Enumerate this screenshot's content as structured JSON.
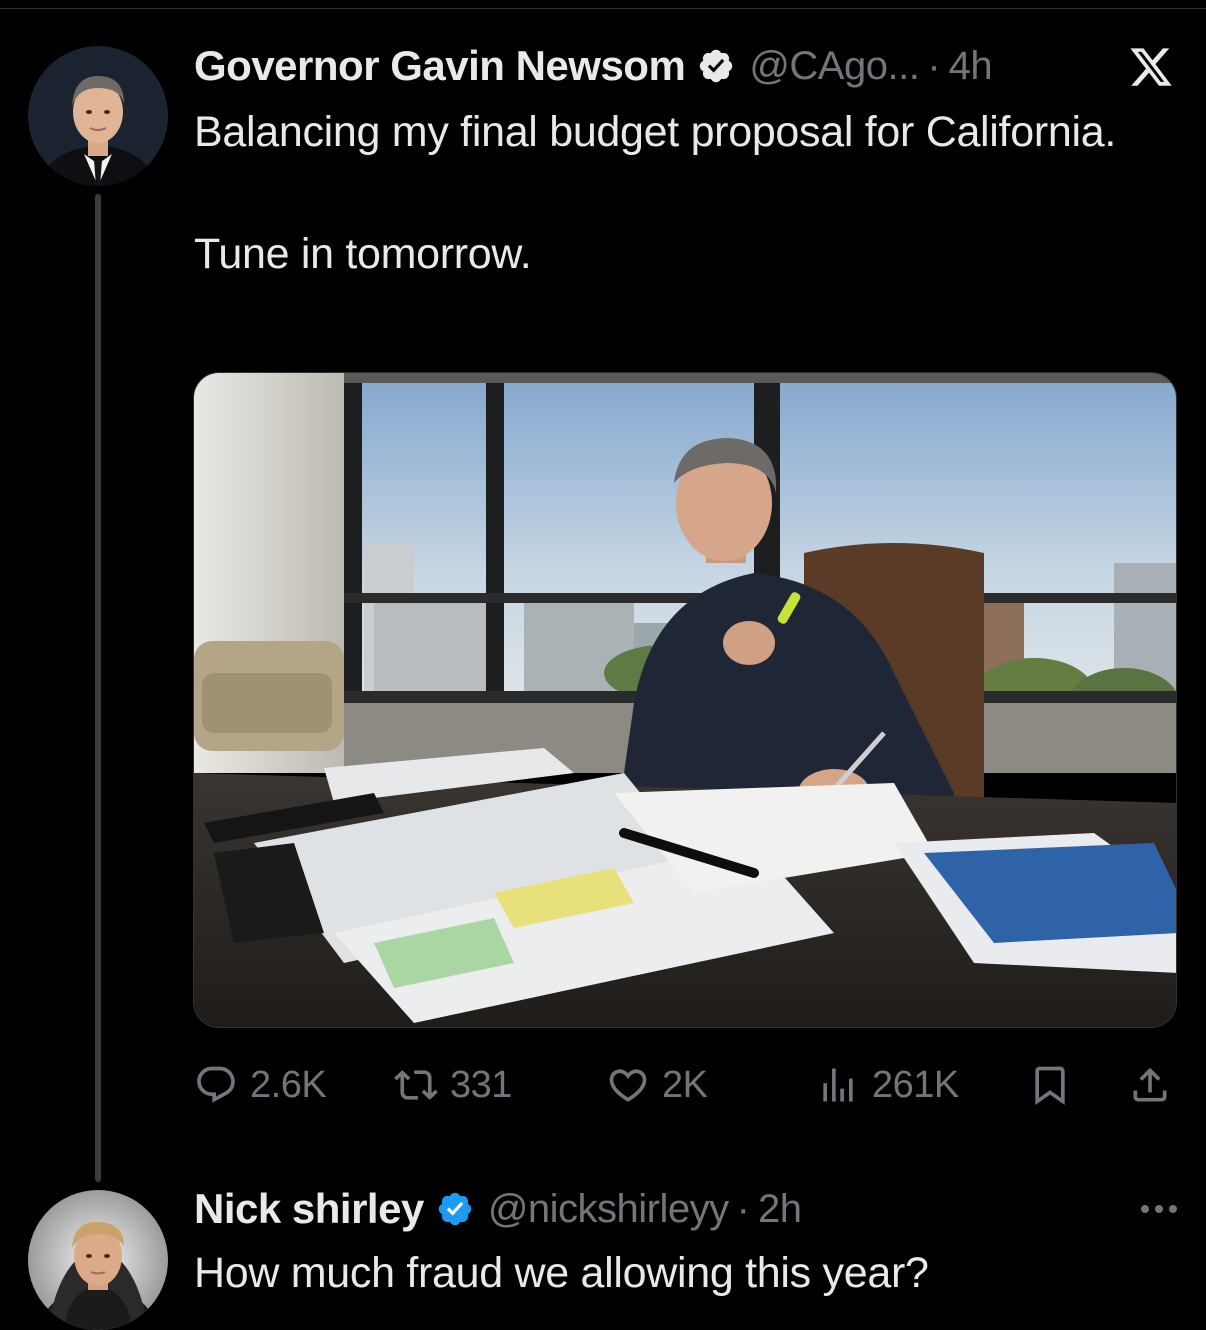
{
  "tweet": {
    "author": {
      "name": "Governor Gavin Newsom",
      "handle": "@CAgo...",
      "verified": true
    },
    "separator": "·",
    "time": "4h",
    "text": "Balancing my final budget proposal for California.\n\nTune in tomorrow.",
    "stats": {
      "replies": "2.6K",
      "reposts": "331",
      "likes": "2K",
      "views": "261K"
    }
  },
  "reply": {
    "author": {
      "name": "Nick shirley",
      "handle": "@nickshirleyy",
      "verified": true
    },
    "separator": "·",
    "time": "2h",
    "text": "How much fraud we allowing this year?"
  },
  "colors": {
    "background": "#000000",
    "text": "#e7e9ea",
    "secondary": "#71767b",
    "verified": "#1d9bf0",
    "thread_line": "#3a3d40"
  },
  "icons": [
    "x-logo-icon",
    "verified-badge-icon",
    "reply-icon",
    "repost-icon",
    "like-icon",
    "views-icon",
    "bookmark-icon",
    "share-icon",
    "more-icon"
  ]
}
